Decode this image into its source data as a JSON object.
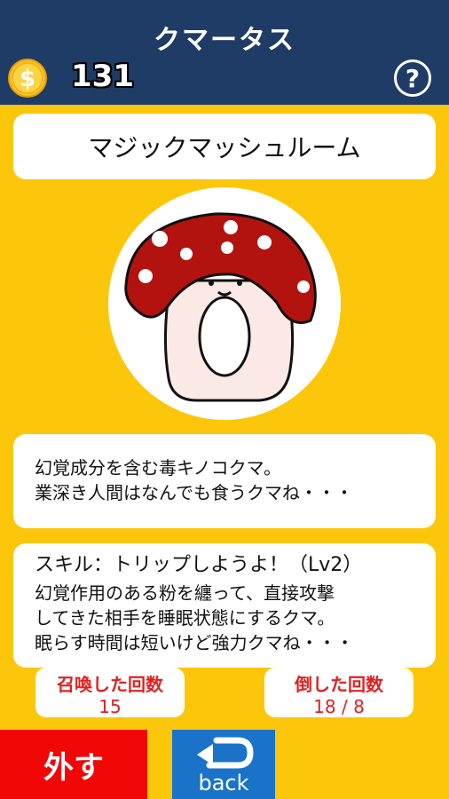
{
  "header": {
    "title": "クマータス",
    "coin_count": "131",
    "help_icon_label": "?"
  },
  "bear": {
    "name": "マジックマッシュルーム",
    "description_lines": [
      "幻覚成分を含む毒キノコクマ。",
      "業深き人間はなんでも食うクマね・・・"
    ],
    "skill": {
      "title": "スキル：トリップしようよ！（Lv2）",
      "lines": [
        "幻覚作用のある粉を纏って、直接攻撃",
        "してきた相手を睡眠状態にするクマ。",
        "眠らす時間は短いけど強力クマね・・・"
      ]
    }
  },
  "stats": {
    "summon_label": "召喚した回数",
    "summon_value": "15",
    "defeated_label": "倒した回数",
    "defeated_value": "18 / 8"
  },
  "buttons": {
    "remove_label": "外す",
    "back_label": "back"
  },
  "icons": {
    "coin": "coin-icon",
    "help": "question-icon",
    "back_arrow": "back-arrow-icon"
  },
  "colors": {
    "background": "#fcc60b",
    "header": "#1f3c66",
    "remove": "#f20707",
    "back": "#1a73c8",
    "stat_text": "#e02020",
    "mushroom_cap": "#b3130f"
  }
}
